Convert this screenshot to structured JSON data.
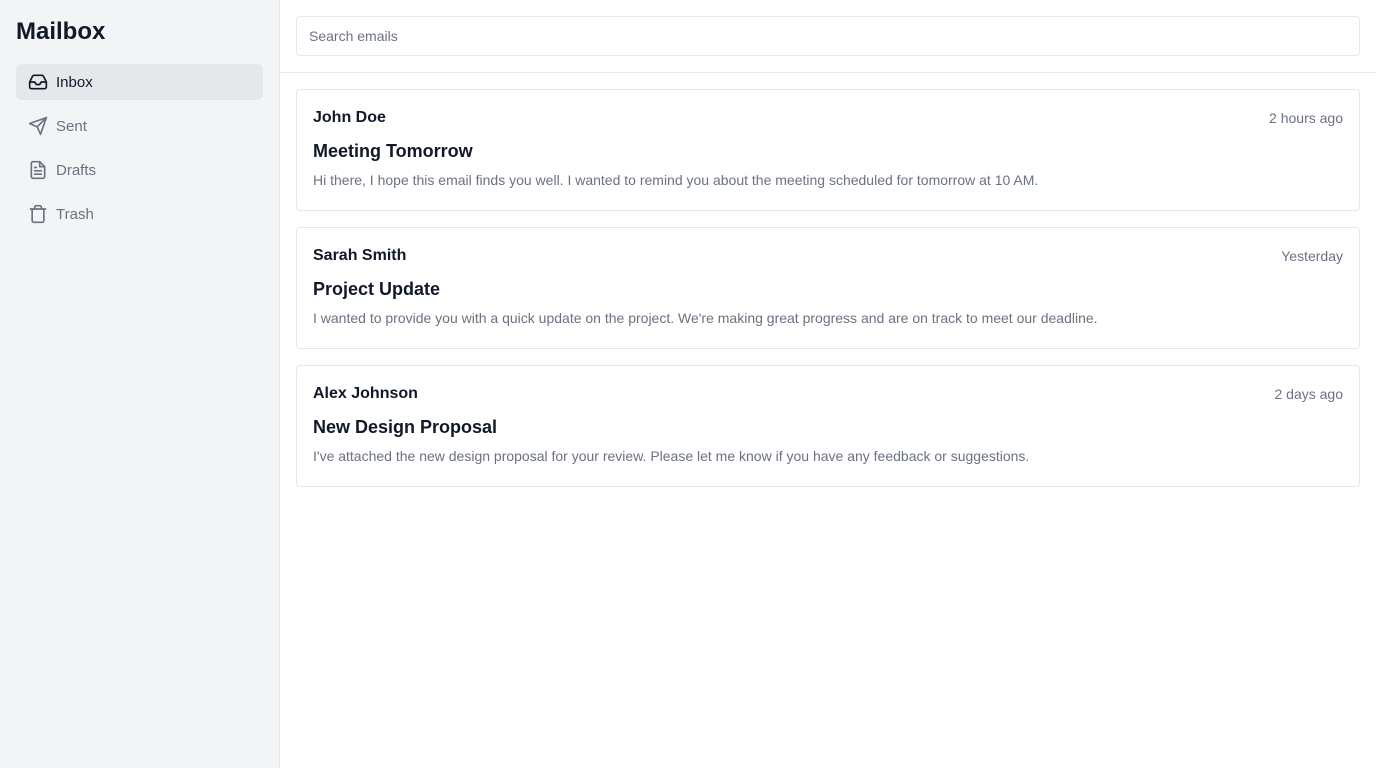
{
  "app": {
    "title": "Mailbox"
  },
  "sidebar": {
    "items": [
      {
        "label": "Inbox",
        "icon": "inbox-icon",
        "active": true
      },
      {
        "label": "Sent",
        "icon": "send-icon",
        "active": false
      },
      {
        "label": "Drafts",
        "icon": "file-text-icon",
        "active": false
      },
      {
        "label": "Trash",
        "icon": "trash-icon",
        "active": false
      }
    ]
  },
  "search": {
    "placeholder": "Search emails",
    "value": ""
  },
  "emails": [
    {
      "sender": "John Doe",
      "time": "2 hours ago",
      "subject": "Meeting Tomorrow",
      "preview": "Hi there, I hope this email finds you well. I wanted to remind you about the meeting scheduled for tomorrow at 10 AM."
    },
    {
      "sender": "Sarah Smith",
      "time": "Yesterday",
      "subject": "Project Update",
      "preview": "I wanted to provide you with a quick update on the project. We're making great progress and are on track to meet our deadline."
    },
    {
      "sender": "Alex Johnson",
      "time": "2 days ago",
      "subject": "New Design Proposal",
      "preview": "I've attached the new design proposal for your review. Please let me know if you have any feedback or suggestions."
    }
  ],
  "colors": {
    "sidebar_bg": "#f3f4f6",
    "active_bg": "#e5e7eb",
    "border": "#e5e7eb",
    "muted_text": "#6b7280",
    "text": "#111827"
  }
}
